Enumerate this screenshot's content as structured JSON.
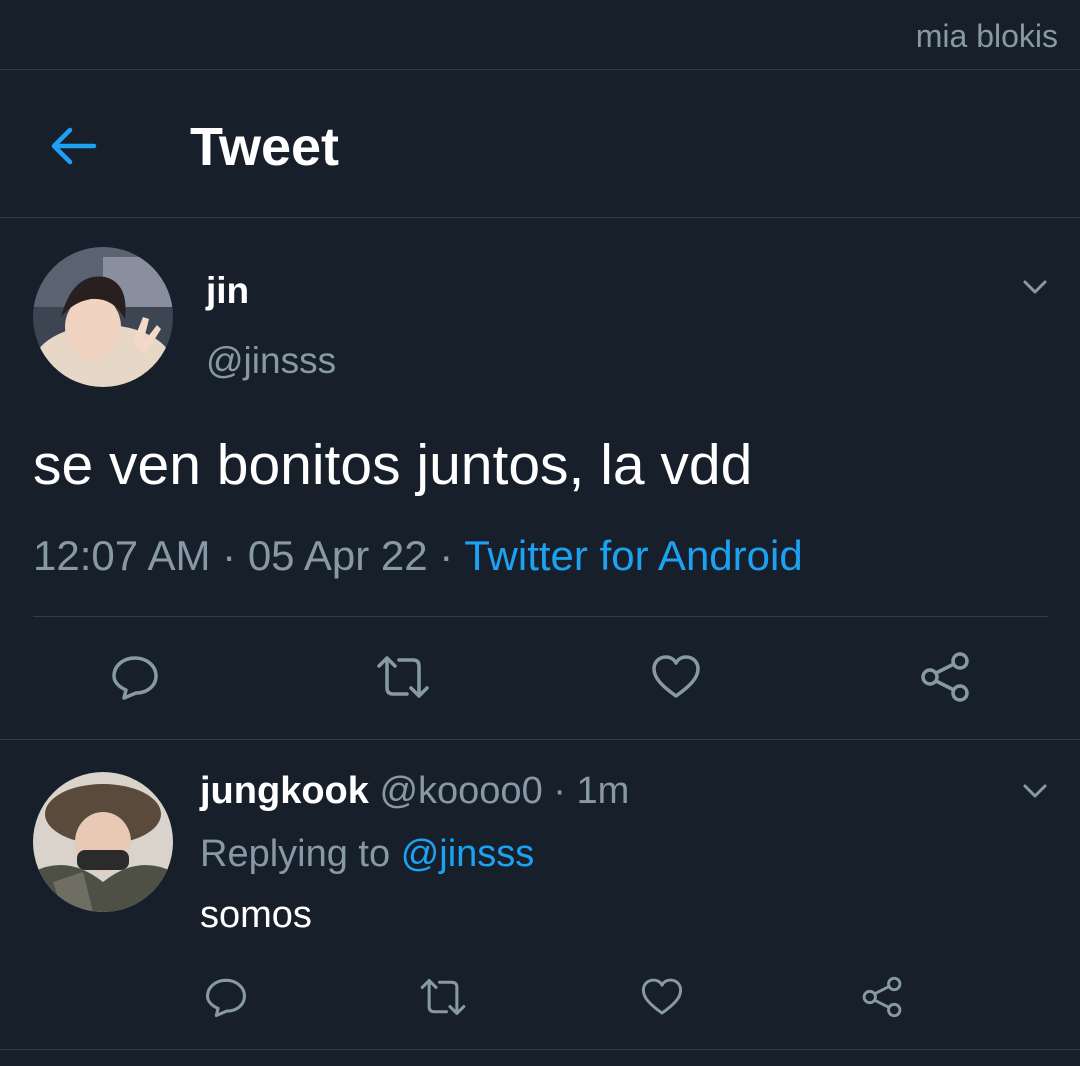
{
  "watermark": "mia blokis",
  "header": {
    "title": "Tweet",
    "back_icon": "arrow-left-icon"
  },
  "colors": {
    "background": "#17202a",
    "accent": "#1da1f2",
    "muted": "#8899a6",
    "divider": "#2f3b47"
  },
  "main_tweet": {
    "display_name": "jin",
    "handle": "@jinsss",
    "text": "se ven bonitos juntos, la vdd",
    "time": "12:07 AM",
    "separator": "·",
    "date": "05 Apr 22",
    "source": "Twitter for Android",
    "actions": [
      "reply-icon",
      "retweet-icon",
      "like-icon",
      "share-icon"
    ]
  },
  "reply": {
    "display_name": "jungkook",
    "handle": "@koooo0",
    "separator": "·",
    "age": "1m",
    "replying_prefix": "Replying to",
    "replying_handle": "@jinsss",
    "text": "somos",
    "actions": [
      "reply-icon",
      "retweet-icon",
      "like-icon",
      "share-icon"
    ]
  }
}
